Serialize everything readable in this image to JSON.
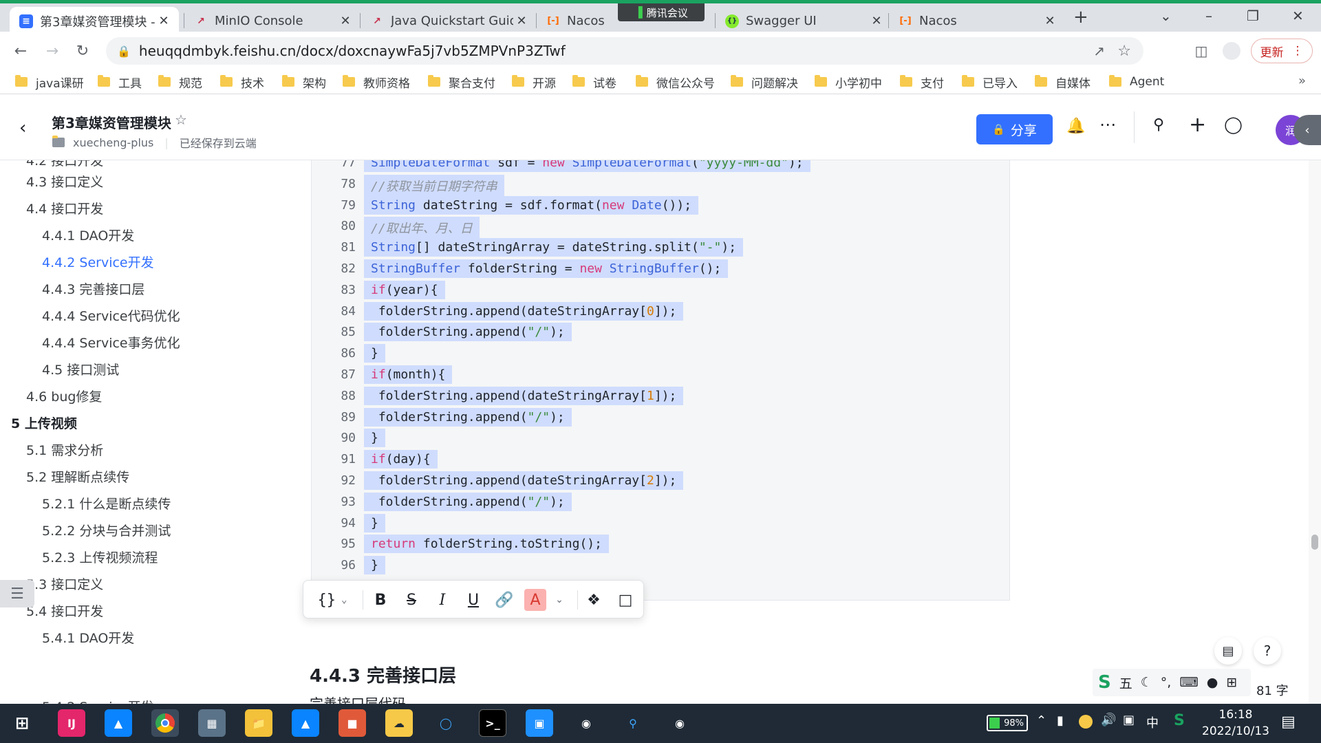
{
  "browser": {
    "tabs": [
      {
        "title": "第3章媒资管理模块 -",
        "icon": "feishu-doc-icon",
        "color": "#3370ff"
      },
      {
        "title": "MinIO Console",
        "icon": "minio-icon",
        "color": "#c72e49"
      },
      {
        "title": "Java Quickstart Guid",
        "icon": "minio-icon",
        "color": "#c72e49"
      },
      {
        "title": "Nacos",
        "icon": "nacos-icon",
        "color": "#ff6a00"
      },
      {
        "title": "Swagger UI",
        "icon": "swagger-icon",
        "color": "#85ea2d"
      },
      {
        "title": "Nacos",
        "icon": "nacos-icon",
        "color": "#ff6a00"
      }
    ],
    "overlay_label": "腾讯会议",
    "url": "heuqqdmbyk.feishu.cn/docx/doxcnaywFa5j7vb5ZMPVnP3ZTwf",
    "update_label": "更新",
    "bookmarks": [
      "java课研",
      "工具",
      "规范",
      "技术",
      "架构",
      "教师资格",
      "聚合支付",
      "开源",
      "试卷",
      "微信公众号",
      "问题解决",
      "小学初中",
      "支付",
      "已导入",
      "自媒体",
      "Agent"
    ]
  },
  "doc": {
    "title": "第3章媒资管理模块",
    "folder": "xuecheng-plus",
    "save_status": "已经保存到云端",
    "share_label": "分享",
    "avatar_text": "润"
  },
  "toc": [
    {
      "label": "4.3 接口定义",
      "level": 1
    },
    {
      "label": "4.4 接口开发",
      "level": 1
    },
    {
      "label": "4.4.1 DAO开发",
      "level": 2
    },
    {
      "label": "4.4.2 Service开发",
      "level": 2,
      "active": true
    },
    {
      "label": "4.4.3 完善接口层",
      "level": 2
    },
    {
      "label": "4.4.4 Service代码优化",
      "level": 2
    },
    {
      "label": "4.4.4 Service事务优化",
      "level": 2
    },
    {
      "label": "4.5 接口测试",
      "level": 2
    },
    {
      "label": "4.6 bug修复",
      "level": 1
    },
    {
      "label": "5 上传视频",
      "level": 0
    },
    {
      "label": "5.1 需求分析",
      "level": 1
    },
    {
      "label": "5.2 理解断点续传",
      "level": 1
    },
    {
      "label": "5.2.1 什么是断点续传",
      "level": 2
    },
    {
      "label": "5.2.2 分块与合并测试",
      "level": 2
    },
    {
      "label": "5.2.3 上传视频流程",
      "level": 2
    },
    {
      "label": "5.3 接口定义",
      "level": 1
    },
    {
      "label": "5.4 接口开发",
      "level": 1
    },
    {
      "label": "5.4.1 DAO开发",
      "level": 2
    }
  ],
  "code_lines": [
    {
      "n": "77",
      "text": "SimpleDateFormat sdf = new SimpleDateFormat(\"yyyy-MM-dd\");"
    },
    {
      "n": "78",
      "text": "//获取当前日期字符串"
    },
    {
      "n": "79",
      "text": "String dateString = sdf.format(new Date());"
    },
    {
      "n": "80",
      "text": "//取出年、月、日"
    },
    {
      "n": "81",
      "text": "String[] dateStringArray = dateString.split(\"-\");"
    },
    {
      "n": "82",
      "text": "StringBuffer folderString = new StringBuffer();"
    },
    {
      "n": "83",
      "text": "if(year){"
    },
    {
      "n": "84",
      "text": " folderString.append(dateStringArray[0]);"
    },
    {
      "n": "85",
      "text": " folderString.append(\"/\");"
    },
    {
      "n": "86",
      "text": "}"
    },
    {
      "n": "87",
      "text": "if(month){"
    },
    {
      "n": "88",
      "text": " folderString.append(dateStringArray[1]);"
    },
    {
      "n": "89",
      "text": " folderString.append(\"/\");"
    },
    {
      "n": "90",
      "text": "}"
    },
    {
      "n": "91",
      "text": "if(day){"
    },
    {
      "n": "92",
      "text": " folderString.append(dateStringArray[2]);"
    },
    {
      "n": "93",
      "text": " folderString.append(\"/\");"
    },
    {
      "n": "94",
      "text": "}"
    },
    {
      "n": "95",
      "text": "return folderString.toString();"
    },
    {
      "n": "96",
      "text": "}"
    }
  ],
  "section_heading": "4.4.3 完善接口层",
  "section_sub": "完善接口层代码",
  "ime": {
    "mode": "五",
    "punct": "°,"
  },
  "word_count": "81 字",
  "taskbar": {
    "battery": "98%",
    "lang": "中",
    "time": "16:18",
    "date": "2022/10/13"
  }
}
